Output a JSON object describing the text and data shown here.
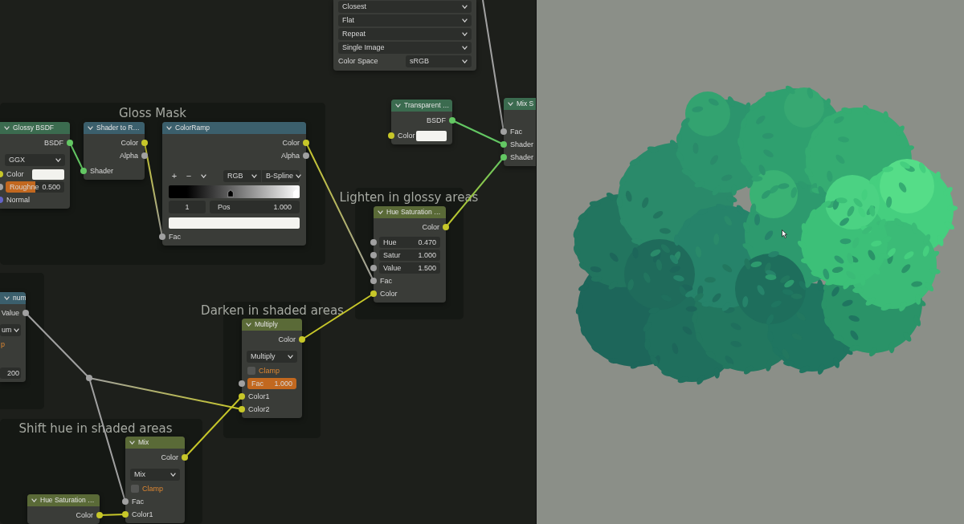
{
  "frames": [
    {
      "label": "Gloss Mask"
    },
    {
      "label": "Lighten in glossy areas"
    },
    {
      "label": "Darken in shaded areas"
    },
    {
      "label": "Shift hue in shaded areas"
    }
  ],
  "nodes": [
    {
      "rows": [
        {
          "kind": "dropdown",
          "value": "Closest"
        },
        {
          "kind": "dropdown",
          "value": "Flat"
        },
        {
          "kind": "dropdown",
          "value": "Repeat"
        },
        {
          "kind": "dropdown",
          "value": "Single Image"
        },
        {
          "kind": "dropdown",
          "label": "Color Space",
          "value": "sRGB"
        }
      ]
    },
    {
      "header": {
        "title": "Glossy BSDF",
        "color": "#3b6b4f"
      },
      "rows": [
        {
          "kind": "output",
          "label": "BSDF",
          "socket": {
            "color": "#63c763"
          }
        },
        {
          "kind": "dropdown",
          "value": "GGX"
        },
        {
          "kind": "color_input",
          "label": "Color",
          "socket": {
            "color": "#c7c729"
          },
          "color": "#f2f2ee"
        },
        {
          "kind": "field",
          "label": "Roughne",
          "value": "0.500",
          "socket": {
            "color": "#a1a1a1"
          },
          "level": 0.5
        },
        {
          "kind": "input",
          "label": "Normal",
          "socket": {
            "color": "#6363c7"
          }
        }
      ]
    },
    {
      "header": {
        "title": "Shader to R…",
        "color": "#3b5f6c"
      },
      "rows": [
        {
          "kind": "output",
          "label": "Color",
          "socket": {
            "color": "#c7c729"
          }
        },
        {
          "kind": "output",
          "label": "Alpha",
          "socket": {
            "color": "#a1a1a1"
          }
        },
        {
          "kind": "input",
          "label": "Shader",
          "socket": {
            "color": "#63c763"
          }
        }
      ]
    },
    {
      "header": {
        "title": "ColorRamp",
        "color": "#3b5f6c"
      },
      "rows": [
        {
          "kind": "output",
          "label": "Color",
          "socket": {
            "color": "#c7c729"
          }
        },
        {
          "kind": "output",
          "label": "Alpha",
          "socket": {
            "color": "#a1a1a1"
          }
        },
        {
          "kind": "ramp_controls",
          "buttons": [
            "+",
            "−"
          ],
          "modes": [
            "RGB",
            "B-Spline"
          ]
        },
        {
          "kind": "ramp_gradient",
          "stops": [
            {
              "level": 0.47,
              "color": "#000000",
              "selected": false
            },
            {
              "level": 1,
              "color": "#ffffff",
              "selected": true
            }
          ]
        },
        {
          "kind": "ramp_fields",
          "index": "1",
          "label": "Pos",
          "value": "1.000"
        },
        {
          "kind": "swatch",
          "color": "#f4f4f0"
        },
        {
          "kind": "input",
          "label": "Fac",
          "socket": {
            "color": "#a1a1a1"
          }
        }
      ]
    },
    {
      "header": {
        "title": "Transparent …",
        "color": "#3b6b4f"
      },
      "rows": [
        {
          "kind": "output",
          "label": "BSDF",
          "socket": {
            "color": "#63c763"
          }
        },
        {
          "kind": "color_input",
          "label": "Color",
          "socket": {
            "color": "#c7c729"
          },
          "color": "#f4f4f0"
        }
      ]
    },
    {
      "header": {
        "title": "Mix S",
        "color": "#3b6b4f"
      },
      "rows": [
        {
          "kind": "input",
          "label": "Fac",
          "socket": {
            "color": "#a1a1a1"
          }
        },
        {
          "kind": "input",
          "label": "Shader",
          "socket": {
            "color": "#63c763"
          }
        },
        {
          "kind": "input",
          "label": "Shader",
          "socket": {
            "color": "#63c763"
          }
        }
      ]
    },
    {
      "header": {
        "title": "Hue Saturation …",
        "color": "#5a6a37"
      },
      "rows": [
        {
          "kind": "output",
          "label": "Color",
          "socket": {
            "color": "#c7c729"
          }
        },
        {
          "kind": "field",
          "label": "Hue",
          "value": "0.470",
          "socket": {
            "color": "#a1a1a1"
          }
        },
        {
          "kind": "field",
          "label": "Satur",
          "value": "1.000",
          "socket": {
            "color": "#a1a1a1"
          }
        },
        {
          "kind": "field",
          "label": "Value",
          "value": "1.500",
          "socket": {
            "color": "#a1a1a1"
          }
        },
        {
          "kind": "input",
          "label": "Fac",
          "socket": {
            "color": "#a1a1a1"
          }
        },
        {
          "kind": "input",
          "label": "Color",
          "socket": {
            "color": "#c7c729"
          }
        }
      ]
    },
    {
      "header": {
        "title": "num",
        "color": "#3b5f6c"
      },
      "rows": [
        {
          "kind": "output",
          "label": "Value",
          "socket": {
            "color": "#a1a1a1"
          }
        },
        {
          "kind": "dropdown",
          "value": "um"
        },
        {
          "kind": "option_label",
          "label": "p"
        },
        {
          "kind": "field",
          "value": "200"
        }
      ]
    },
    {
      "header": {
        "title": "Multiply",
        "color": "#5a6a37"
      },
      "rows": [
        {
          "kind": "output",
          "label": "Color",
          "socket": {
            "color": "#c7c729"
          }
        },
        {
          "kind": "dropdown",
          "value": "Multiply"
        },
        {
          "kind": "checkbox",
          "label": "Clamp",
          "checked": false
        },
        {
          "kind": "field",
          "label": "Fac",
          "value": "1.000",
          "socket": {
            "color": "#a1a1a1"
          },
          "level": 1
        },
        {
          "kind": "input",
          "label": "Color1",
          "socket": {
            "color": "#c7c729"
          }
        },
        {
          "kind": "input",
          "label": "Color2",
          "socket": {
            "color": "#c7c729"
          }
        }
      ]
    },
    {
      "header": {
        "title": "Hue Saturation …",
        "color": "#5a6a37"
      },
      "rows": [
        {
          "kind": "output",
          "label": "Color",
          "socket": {
            "color": "#c7c729"
          }
        }
      ]
    },
    {
      "header": {
        "title": "Mix",
        "color": "#5a6a37"
      },
      "rows": [
        {
          "kind": "output",
          "label": "Color",
          "socket": {
            "color": "#c7c729"
          }
        },
        {
          "kind": "dropdown",
          "value": "Mix"
        },
        {
          "kind": "checkbox",
          "label": "Clamp",
          "checked": false
        },
        {
          "kind": "input",
          "label": "Fac",
          "socket": {
            "color": "#a1a1a1"
          }
        },
        {
          "kind": "input",
          "label": "Color1",
          "socket": {
            "color": "#c7c729"
          }
        }
      ]
    }
  ]
}
